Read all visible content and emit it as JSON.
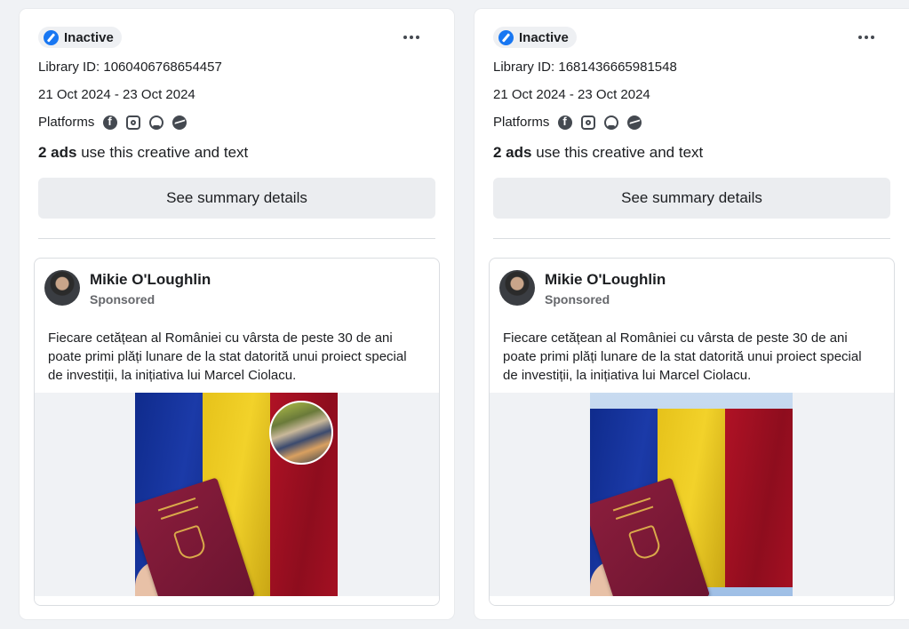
{
  "cards": [
    {
      "status_label": "Inactive",
      "library_id": "Library ID: 1060406768654457",
      "date_range": "21 Oct 2024 - 23 Oct 2024",
      "platforms_label": "Platforms",
      "platform_icons": [
        "facebook-icon",
        "instagram-icon",
        "audience-network-icon",
        "messenger-icon"
      ],
      "ads_count": "2 ads",
      "ads_suffix": "use this creative and text",
      "summary_button": "See summary details",
      "post": {
        "author": "Mikie O'Loughlin",
        "sponsored": "Sponsored",
        "text": "Fiecare cetățean al României cu vârsta de peste 30 de ani poate primi plăți lunare de la stat datorită unui proiect special de investiții, la inițiativa lui Marcel Ciolacu."
      }
    },
    {
      "status_label": "Inactive",
      "library_id": "Library ID: 1681436665981548",
      "date_range": "21 Oct 2024 - 23 Oct 2024",
      "platforms_label": "Platforms",
      "platform_icons": [
        "facebook-icon",
        "instagram-icon",
        "audience-network-icon",
        "messenger-icon"
      ],
      "ads_count": "2 ads",
      "ads_suffix": "use this creative and text",
      "summary_button": "See summary details",
      "post": {
        "author": "Mikie O'Loughlin",
        "sponsored": "Sponsored",
        "text": "Fiecare cetățean al României cu vârsta de peste 30 de ani poate primi plăți lunare de la stat datorită unui proiect special de investiții, la inițiativa lui Marcel Ciolacu."
      }
    }
  ],
  "colors": {
    "page_bg": "#f0f2f5",
    "status_icon": "#1877f2",
    "flag_blue": "#0f2b8c",
    "flag_yellow": "#f2d22a",
    "flag_red": "#a41022",
    "passport": "#8a1d3c"
  }
}
